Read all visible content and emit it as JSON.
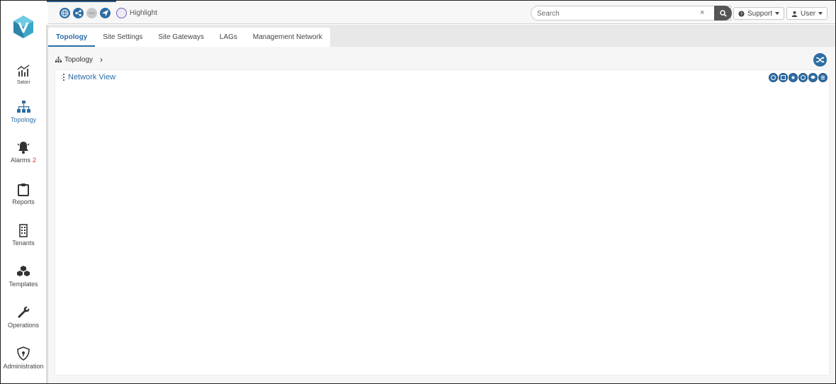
{
  "header": {
    "highlight_label": "Highlight",
    "search_placeholder": "Search",
    "search_clear": "×",
    "support_label": "Support",
    "user_label": "User"
  },
  "sidebar": {
    "items": [
      {
        "label": "Satori",
        "icon": "chart-line-icon"
      },
      {
        "label": "Topology",
        "icon": "sitemap-icon"
      },
      {
        "label": "Alarms",
        "icon": "bell-icon",
        "badge": "2"
      },
      {
        "label": "Reports",
        "icon": "clipboard-icon"
      },
      {
        "label": "Tenants",
        "icon": "building-icon"
      },
      {
        "label": "Templates",
        "icon": "cubes-icon"
      },
      {
        "label": "Operations",
        "icon": "wrench-icon"
      },
      {
        "label": "Administration",
        "icon": "shield-icon"
      }
    ]
  },
  "tabs": [
    {
      "label": "Topology",
      "active": true
    },
    {
      "label": "Site Settings"
    },
    {
      "label": "Site Gateways"
    },
    {
      "label": "LAGs"
    },
    {
      "label": "Management Network"
    }
  ],
  "breadcrumb": {
    "label": "Topology",
    "separator": "›"
  },
  "panel": {
    "title": "Network View"
  },
  "colors": {
    "accent": "#2e6da4",
    "alarm": "#e0302a",
    "logo": "#3aa7c9"
  }
}
